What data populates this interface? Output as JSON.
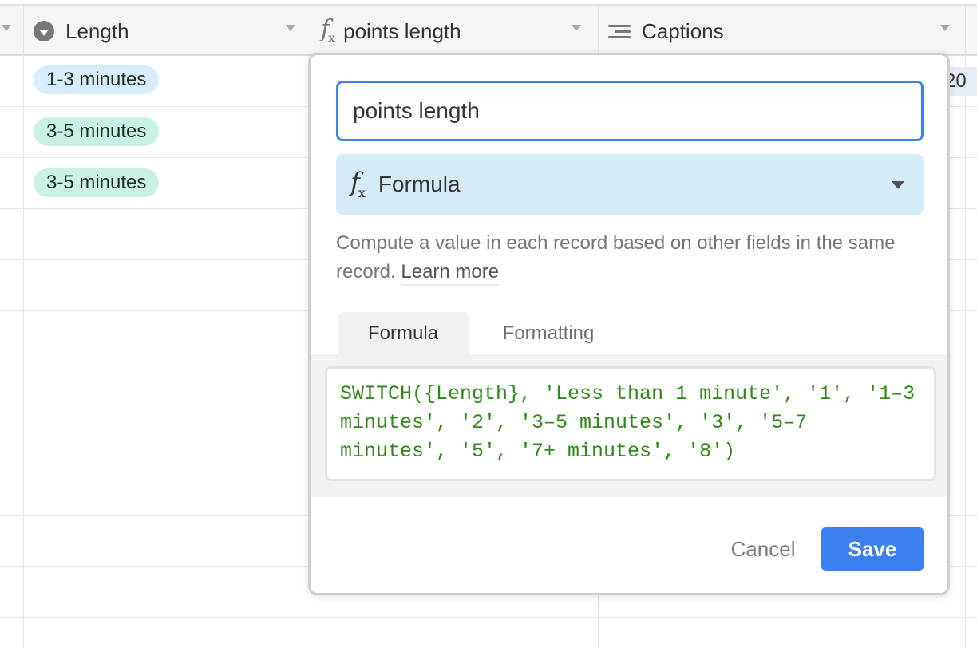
{
  "grid": {
    "columns": [
      {
        "name": "Length",
        "icon": "single-select-icon"
      },
      {
        "name": "points length",
        "icon": "formula-icon"
      },
      {
        "name": "Captions",
        "icon": "long-text-icon"
      }
    ],
    "length_values": [
      "1-3 minutes",
      "3-5 minutes",
      "3-5 minutes"
    ],
    "captions_peek": "20"
  },
  "field_editor": {
    "field_name": "points length",
    "field_type": {
      "label": "Formula",
      "icon": "formula-icon"
    },
    "description": "Compute a value in each record based on other fields in the same record.",
    "learn_more": "Learn more",
    "tabs": [
      {
        "label": "Formula",
        "active": true
      },
      {
        "label": "Formatting",
        "active": false
      }
    ],
    "formula": "SWITCH({Length}, 'Less than 1 minute', '1', '1–3 minutes', '2', '3–5 minutes', '3', '5–7 minutes', '5', '7+ minutes', '8')",
    "cancel_label": "Cancel",
    "save_label": "Save"
  },
  "colors": {
    "accent": "#3b7ff0",
    "select_pill_blue": "#d8ecfb",
    "select_pill_green": "#c9f1e4",
    "type_select_bg": "#d6ebf8",
    "formula_text": "#2e8a17"
  }
}
